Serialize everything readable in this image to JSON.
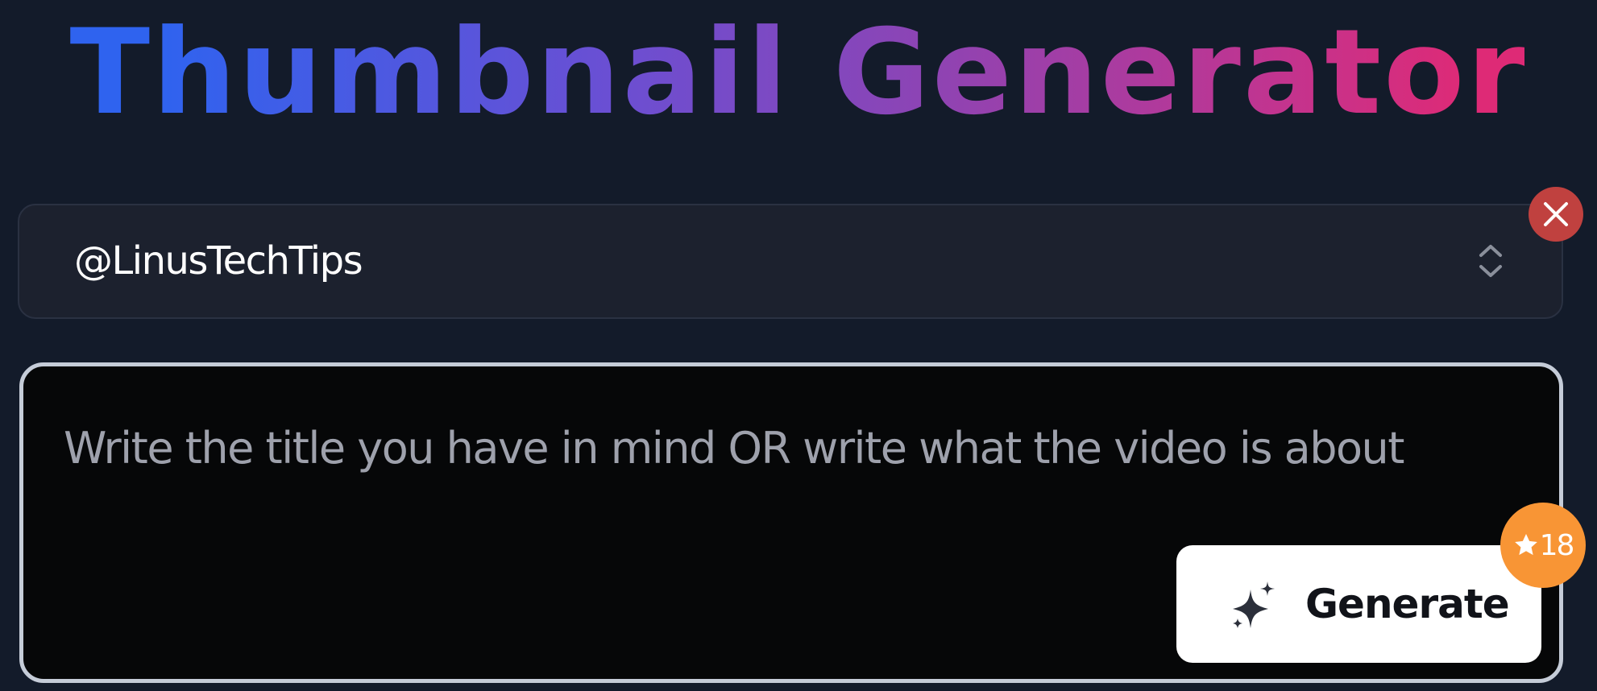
{
  "header": {
    "title": "Thumbnail Generator"
  },
  "channel_select": {
    "value": "@LinusTechTips",
    "icon": "chevron-up-down-icon"
  },
  "clear_button": {
    "icon": "close-icon"
  },
  "prompt": {
    "placeholder": "Write the title you have in mind OR write what the video is about",
    "value": ""
  },
  "generate_button": {
    "label": "Generate",
    "icon": "sparkles-icon"
  },
  "credits": {
    "icon": "star-icon",
    "count": "18"
  },
  "colors": {
    "background": "#131b2a",
    "title_gradient_start": "#2f63ef",
    "title_gradient_mid": "#8d44b4",
    "title_gradient_end": "#de2a76",
    "clear_button": "#c0413f",
    "credits_badge": "#f89535",
    "prompt_border": "#c5ccd8"
  }
}
